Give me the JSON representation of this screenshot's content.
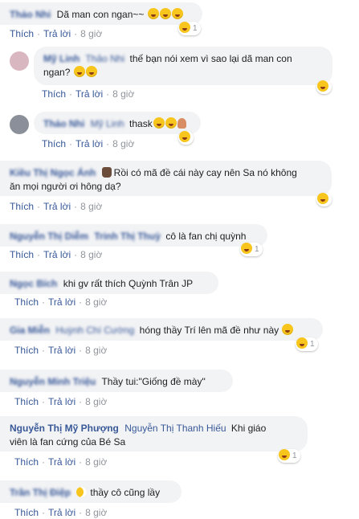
{
  "actions": {
    "like": "Thích",
    "reply": "Trả lời",
    "dot": "·",
    "time": "8 giờ"
  },
  "comments": [
    {
      "name": "Thảo Nhi",
      "text": "Dã man con ngan~~",
      "reaction_count": "1"
    },
    {
      "name": "Mỹ Linh",
      "tag": "Thảo Nhi",
      "text_line1": "thế bạn nói xem vì sao lại dã man con",
      "text_line2": "ngan?",
      "reaction_count": ""
    },
    {
      "name": "Thảo Nhi",
      "tag": "Mỹ Linh",
      "text": "thask",
      "reaction_count": ""
    },
    {
      "name": "Kiều Thị Ngọc Ánh",
      "text_line1": "Rồi có mã đề cái này cay nên Sa nó không",
      "text_line2": "ăn mọi người ơi hông dạ?",
      "reaction_count": ""
    },
    {
      "name": "Nguyễn Thị Diễm",
      "tag": "Trinh Thị Thuỳ",
      "text": "cô là fan chị quỳnh",
      "reaction_count": "1"
    },
    {
      "name": "Ngọc Bích",
      "text": "khi gv rất thích Quỳnh Trân JP",
      "reaction_count": ""
    },
    {
      "name": "Gia Miễn",
      "tag": "Huỳnh Chí Cường",
      "text": "hóng thầy Trí lên mã đề như này",
      "reaction_count": "1"
    },
    {
      "name": "Nguyễn Minh Triệu",
      "text": "Thầy tui:\"Giống đề mày\"",
      "reaction_count": ""
    },
    {
      "name": "Nguyễn Thị Mỹ Phượng",
      "tag": "Nguyễn Thị Thanh Hiếu",
      "text_suffix": "Khi giáo",
      "text_line2": "viên là fan cứng của Bé Sa",
      "reaction_count": "1"
    },
    {
      "name": "Trần Thị Điệp",
      "text": "thầy cô cũng lầy",
      "reaction_count": ""
    }
  ]
}
